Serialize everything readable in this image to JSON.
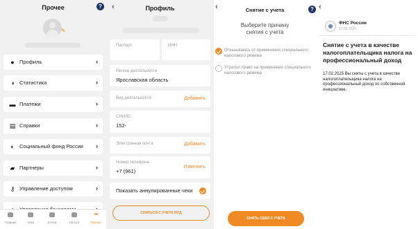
{
  "colors": {
    "accent": "#f08a24",
    "help_badge": "#1f3266",
    "panel_bg": "#f1f1f1"
  },
  "other": {
    "title": "Прочее",
    "help_label": "?",
    "menu": [
      {
        "label": "Профиль",
        "icon": "user-icon"
      },
      {
        "label": "Статистика",
        "icon": "pie-chart-icon"
      },
      {
        "label": "Платежи",
        "icon": "wallet-icon"
      },
      {
        "label": "Справки",
        "icon": "document-icon"
      },
      {
        "label": "Социальный фонд России",
        "icon": "shield-icon"
      },
      {
        "label": "Партнеры",
        "icon": "briefcase-icon"
      },
      {
        "label": "Управление доступом",
        "icon": "key-icon"
      },
      {
        "label": "Управление банкерами",
        "icon": "bank-icon"
      }
    ],
    "tabs": [
      {
        "label": "Главная",
        "active": false
      },
      {
        "label": "Чеки",
        "active": false
      },
      {
        "label": "Счета",
        "active": false
      },
      {
        "label": "Налоги",
        "active": false
      },
      {
        "label": "Прочее",
        "active": true
      }
    ]
  },
  "profile": {
    "title": "Профиль",
    "fields": {
      "passport_label": "Паспорт",
      "inn_label": "ИНН",
      "region_label": "Регион деятельности",
      "region_value": "Ярославская область",
      "activity_label": "Вид деятельности",
      "activity_action": "Добавить",
      "snils_label": "СНИЛС",
      "snils_value": "152-",
      "email_label": "Электронная почта",
      "email_action": "Добавить",
      "phone_label": "Номер телефона",
      "phone_value": "+7 (961)",
      "phone_action": "Изменить",
      "annulled_label": "Показать аннулированные чеки"
    },
    "deregister_button": "СНЯТЬСЯ С УЧЕТА НПД"
  },
  "deregister": {
    "title": "Снятие с учета",
    "prompt_line1": "Выберите причину",
    "prompt_line2": "снятия с учета",
    "options": [
      {
        "label": "Отказываюсь от применения специального налогового режима",
        "checked": true
      },
      {
        "label": "Утратил право на применение специального налогового режима",
        "checked": false
      }
    ],
    "submit_button": "СНЯТЬ СЕБЯ С УЧЕТА"
  },
  "message": {
    "help_label": "?",
    "sender": "ФНС России",
    "date": "17.02.2025",
    "title": "Снятие с учета в качестве налогоплательщика налога на профессиональный доход",
    "body": "17.02.2025 Вы сняты с учета в качестве налогоплательщика налога на профессиональный доход по собственной инициативе."
  }
}
